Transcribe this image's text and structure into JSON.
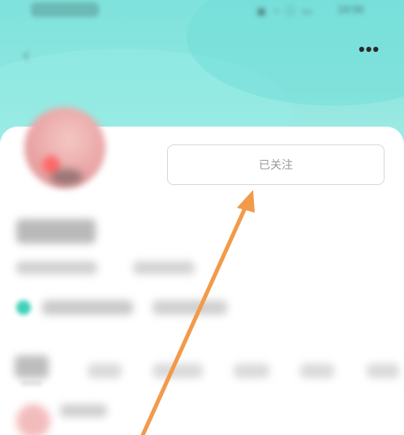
{
  "profile": {
    "follow_button_label": "已关注"
  },
  "status_bar": {
    "time": "19:56"
  },
  "colors": {
    "banner": "#8ee6df",
    "annotation_arrow": "#f29a49",
    "button_border": "#d7d7d7"
  }
}
